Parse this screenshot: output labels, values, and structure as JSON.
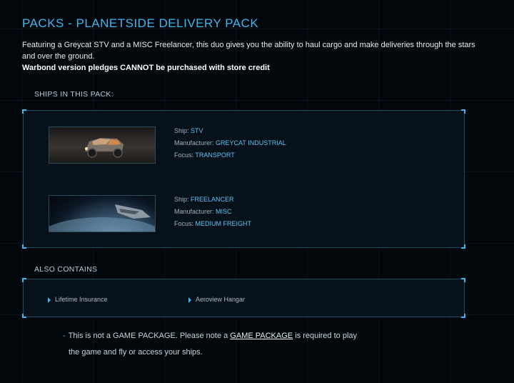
{
  "page": {
    "title": "PACKS - PLANETSIDE DELIVERY PACK",
    "description": "Featuring a Greycat STV and a MISC Freelancer, this duo gives you the ability to haul cargo and make deliveries through the stars and over the ground.",
    "warning": "Warbond version pledges CANNOT be purchased with store credit"
  },
  "ships_section": {
    "label": "SHIPS IN THIS PACK:",
    "ships": [
      {
        "ship_label": "Ship:",
        "ship": "STV",
        "manufacturer_label": "Manufacturer:",
        "manufacturer": "GREYCAT INDUSTRIAL",
        "focus_label": "Focus:",
        "focus": "TRANSPORT"
      },
      {
        "ship_label": "Ship:",
        "ship": "FREELANCER",
        "manufacturer_label": "Manufacturer:",
        "manufacturer": "MISC",
        "focus_label": "Focus:",
        "focus": "MEDIUM FREIGHT"
      }
    ]
  },
  "contains_section": {
    "label": "ALSO CONTAINS",
    "items": [
      "Lifetime Insurance",
      "Aeroview Hangar"
    ]
  },
  "note": {
    "dash": "-",
    "part1": "This is not a GAME PACKAGE. Please note a",
    "link": "GAME PACKAGE",
    "part2": "is required to play",
    "line2": "the game and fly or access your ships."
  },
  "colors": {
    "accent": "#3fb7ef",
    "value_text": "#5fc3f4",
    "background": "#02070b"
  }
}
